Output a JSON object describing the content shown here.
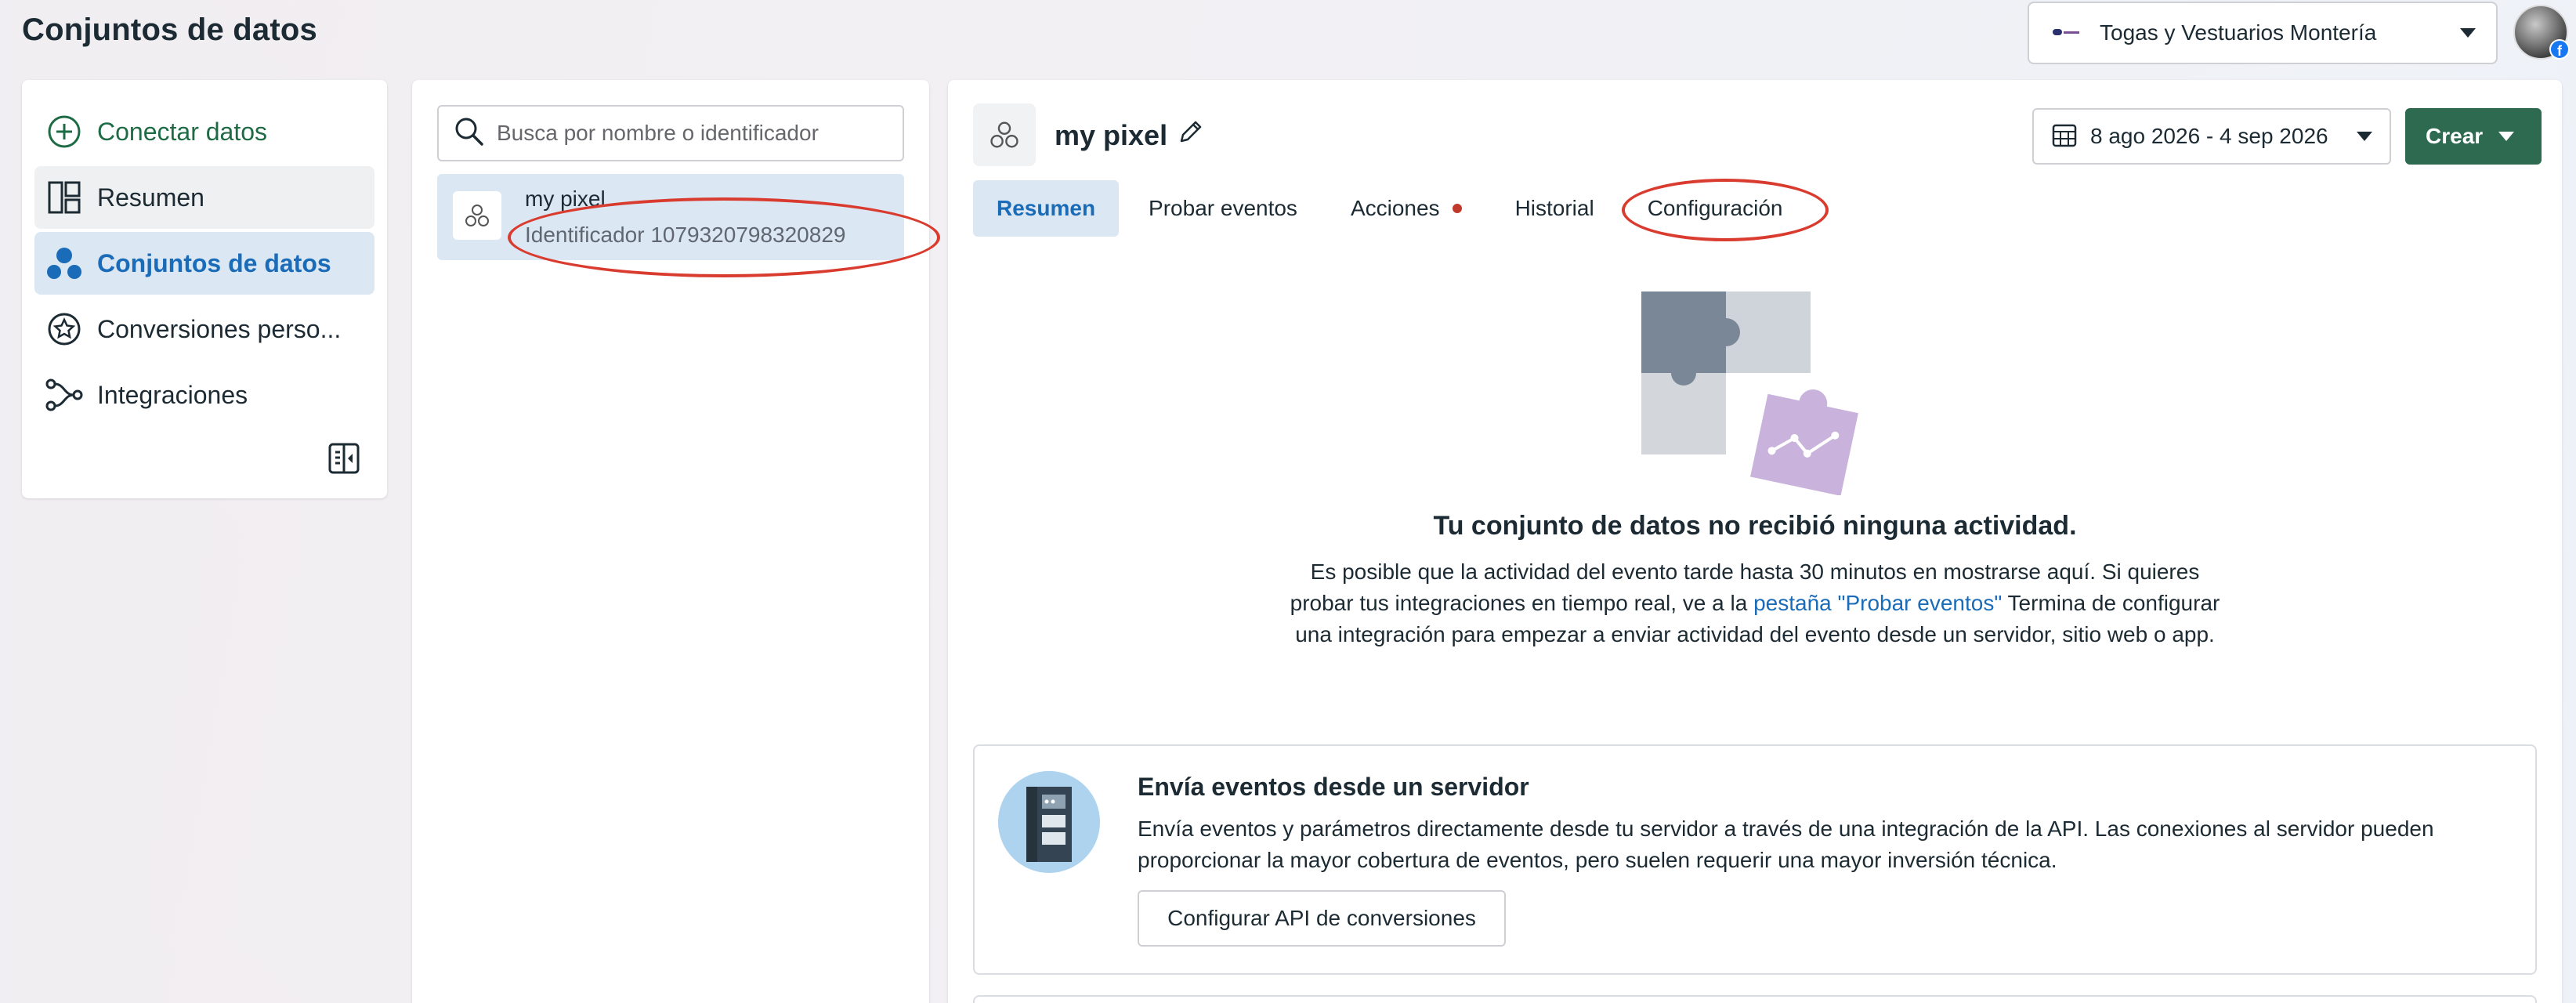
{
  "page": {
    "title": "Conjuntos de datos"
  },
  "account": {
    "name": "Togas y Vestuarios Montería"
  },
  "nav": {
    "items": [
      {
        "label": "Conectar datos"
      },
      {
        "label": "Resumen"
      },
      {
        "label": "Conjuntos de datos"
      },
      {
        "label": "Conversiones perso..."
      },
      {
        "label": "Integraciones"
      }
    ]
  },
  "search": {
    "placeholder": "Busca por nombre o identificador"
  },
  "dataset": {
    "name": "my pixel",
    "id_text": "Identificador 1079320798320829"
  },
  "main": {
    "title": "my pixel",
    "date_range": "8 ago 2026 - 4 sep 2026",
    "create_label": "Crear",
    "tabs": [
      {
        "label": "Resumen"
      },
      {
        "label": "Probar eventos"
      },
      {
        "label": "Acciones"
      },
      {
        "label": "Historial"
      },
      {
        "label": "Configuración"
      }
    ],
    "empty": {
      "title": "Tu conjunto de datos no recibió ninguna actividad.",
      "desc_before": "Es posible que la actividad del evento tarde hasta 30 minutos en mostrarse aquí. Si quieres probar tus integraciones en tiempo real, ve a la ",
      "desc_link": "pestaña \"Probar eventos\"",
      "desc_after": " Termina de configurar una integración para empezar a enviar actividad del evento desde un servidor, sitio web o app."
    },
    "server_card": {
      "title": "Envía eventos desde un servidor",
      "desc": "Envía eventos y parámetros directamente desde tu servidor a través de una integración de la API. Las conexiones al servidor pueden proporcionar la mayor cobertura de eventos, pero suelen requerir una mayor inversión técnica.",
      "button": "Configurar API de conversiones"
    }
  },
  "colors": {
    "accent_blue": "#1a6bb8",
    "brand_green": "#2d6a4f",
    "annotation_red": "#d93b2e"
  }
}
